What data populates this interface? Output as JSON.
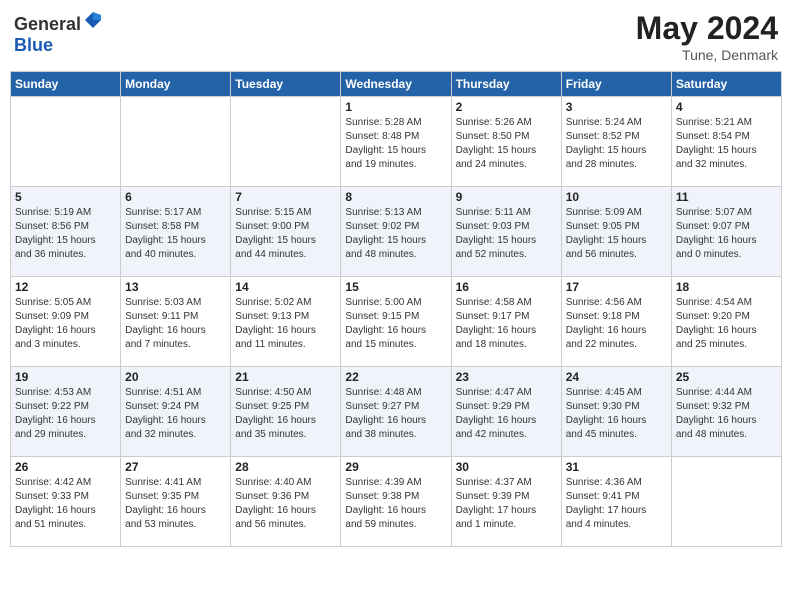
{
  "header": {
    "logo_general": "General",
    "logo_blue": "Blue",
    "title": "May 2024",
    "location": "Tune, Denmark"
  },
  "days_of_week": [
    "Sunday",
    "Monday",
    "Tuesday",
    "Wednesday",
    "Thursday",
    "Friday",
    "Saturday"
  ],
  "weeks": [
    [
      {
        "day": "",
        "info": ""
      },
      {
        "day": "",
        "info": ""
      },
      {
        "day": "",
        "info": ""
      },
      {
        "day": "1",
        "info": "Sunrise: 5:28 AM\nSunset: 8:48 PM\nDaylight: 15 hours\nand 19 minutes."
      },
      {
        "day": "2",
        "info": "Sunrise: 5:26 AM\nSunset: 8:50 PM\nDaylight: 15 hours\nand 24 minutes."
      },
      {
        "day": "3",
        "info": "Sunrise: 5:24 AM\nSunset: 8:52 PM\nDaylight: 15 hours\nand 28 minutes."
      },
      {
        "day": "4",
        "info": "Sunrise: 5:21 AM\nSunset: 8:54 PM\nDaylight: 15 hours\nand 32 minutes."
      }
    ],
    [
      {
        "day": "5",
        "info": "Sunrise: 5:19 AM\nSunset: 8:56 PM\nDaylight: 15 hours\nand 36 minutes."
      },
      {
        "day": "6",
        "info": "Sunrise: 5:17 AM\nSunset: 8:58 PM\nDaylight: 15 hours\nand 40 minutes."
      },
      {
        "day": "7",
        "info": "Sunrise: 5:15 AM\nSunset: 9:00 PM\nDaylight: 15 hours\nand 44 minutes."
      },
      {
        "day": "8",
        "info": "Sunrise: 5:13 AM\nSunset: 9:02 PM\nDaylight: 15 hours\nand 48 minutes."
      },
      {
        "day": "9",
        "info": "Sunrise: 5:11 AM\nSunset: 9:03 PM\nDaylight: 15 hours\nand 52 minutes."
      },
      {
        "day": "10",
        "info": "Sunrise: 5:09 AM\nSunset: 9:05 PM\nDaylight: 15 hours\nand 56 minutes."
      },
      {
        "day": "11",
        "info": "Sunrise: 5:07 AM\nSunset: 9:07 PM\nDaylight: 16 hours\nand 0 minutes."
      }
    ],
    [
      {
        "day": "12",
        "info": "Sunrise: 5:05 AM\nSunset: 9:09 PM\nDaylight: 16 hours\nand 3 minutes."
      },
      {
        "day": "13",
        "info": "Sunrise: 5:03 AM\nSunset: 9:11 PM\nDaylight: 16 hours\nand 7 minutes."
      },
      {
        "day": "14",
        "info": "Sunrise: 5:02 AM\nSunset: 9:13 PM\nDaylight: 16 hours\nand 11 minutes."
      },
      {
        "day": "15",
        "info": "Sunrise: 5:00 AM\nSunset: 9:15 PM\nDaylight: 16 hours\nand 15 minutes."
      },
      {
        "day": "16",
        "info": "Sunrise: 4:58 AM\nSunset: 9:17 PM\nDaylight: 16 hours\nand 18 minutes."
      },
      {
        "day": "17",
        "info": "Sunrise: 4:56 AM\nSunset: 9:18 PM\nDaylight: 16 hours\nand 22 minutes."
      },
      {
        "day": "18",
        "info": "Sunrise: 4:54 AM\nSunset: 9:20 PM\nDaylight: 16 hours\nand 25 minutes."
      }
    ],
    [
      {
        "day": "19",
        "info": "Sunrise: 4:53 AM\nSunset: 9:22 PM\nDaylight: 16 hours\nand 29 minutes."
      },
      {
        "day": "20",
        "info": "Sunrise: 4:51 AM\nSunset: 9:24 PM\nDaylight: 16 hours\nand 32 minutes."
      },
      {
        "day": "21",
        "info": "Sunrise: 4:50 AM\nSunset: 9:25 PM\nDaylight: 16 hours\nand 35 minutes."
      },
      {
        "day": "22",
        "info": "Sunrise: 4:48 AM\nSunset: 9:27 PM\nDaylight: 16 hours\nand 38 minutes."
      },
      {
        "day": "23",
        "info": "Sunrise: 4:47 AM\nSunset: 9:29 PM\nDaylight: 16 hours\nand 42 minutes."
      },
      {
        "day": "24",
        "info": "Sunrise: 4:45 AM\nSunset: 9:30 PM\nDaylight: 16 hours\nand 45 minutes."
      },
      {
        "day": "25",
        "info": "Sunrise: 4:44 AM\nSunset: 9:32 PM\nDaylight: 16 hours\nand 48 minutes."
      }
    ],
    [
      {
        "day": "26",
        "info": "Sunrise: 4:42 AM\nSunset: 9:33 PM\nDaylight: 16 hours\nand 51 minutes."
      },
      {
        "day": "27",
        "info": "Sunrise: 4:41 AM\nSunset: 9:35 PM\nDaylight: 16 hours\nand 53 minutes."
      },
      {
        "day": "28",
        "info": "Sunrise: 4:40 AM\nSunset: 9:36 PM\nDaylight: 16 hours\nand 56 minutes."
      },
      {
        "day": "29",
        "info": "Sunrise: 4:39 AM\nSunset: 9:38 PM\nDaylight: 16 hours\nand 59 minutes."
      },
      {
        "day": "30",
        "info": "Sunrise: 4:37 AM\nSunset: 9:39 PM\nDaylight: 17 hours\nand 1 minute."
      },
      {
        "day": "31",
        "info": "Sunrise: 4:36 AM\nSunset: 9:41 PM\nDaylight: 17 hours\nand 4 minutes."
      },
      {
        "day": "",
        "info": ""
      }
    ]
  ]
}
